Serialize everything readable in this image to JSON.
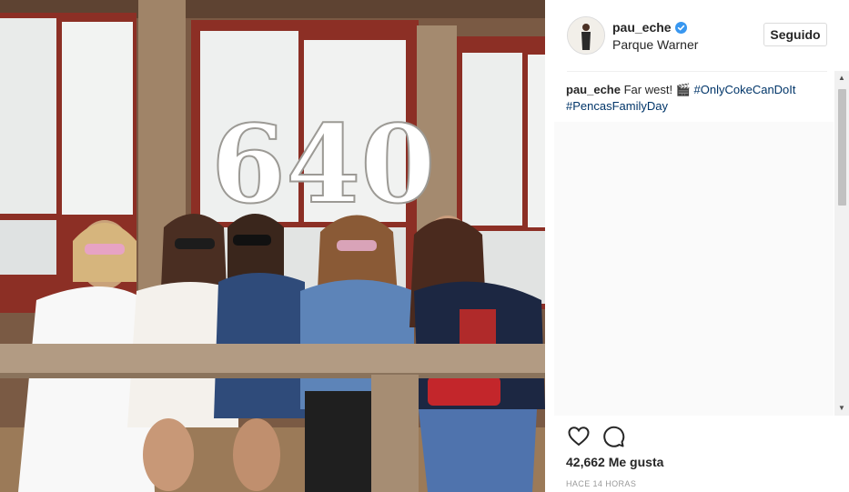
{
  "post": {
    "image_alt": "Five women sitting on a wooden porch bench",
    "sign_text": "640"
  },
  "header": {
    "username": "pau_eche",
    "location": "Parque Warner",
    "follow_label": "Seguido",
    "verified_icon": "verified-badge-icon"
  },
  "caption": {
    "username": "pau_eche",
    "text": "Far west!",
    "emoji": "🎬",
    "hashtag_1": "#OnlyCokeCanDoIt",
    "hashtag_2": "#PencasFamilyDay"
  },
  "actions": {
    "like_icon": "heart-icon",
    "comment_icon": "comment-bubble-icon"
  },
  "likes": "42,662 Me gusta",
  "timestamp": "HACE 14 HORAS",
  "colors": {
    "text": "#262626",
    "hashtag": "#003569",
    "muted": "#999999",
    "verified": "#3897f0",
    "border": "#dbdbdb"
  }
}
